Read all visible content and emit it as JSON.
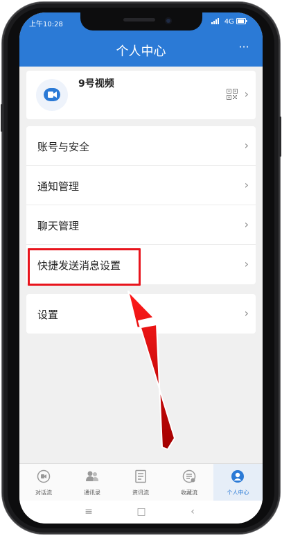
{
  "status_bar": {
    "time": "上午10:28",
    "network": "4G"
  },
  "header": {
    "title": "个人中心",
    "more_label": "···"
  },
  "profile": {
    "name": "9号视频"
  },
  "menu_group_1": [
    {
      "label": "账号与安全"
    },
    {
      "label": "通知管理"
    },
    {
      "label": "聊天管理"
    },
    {
      "label": "快捷发送消息设置"
    }
  ],
  "menu_group_2": [
    {
      "label": "设置"
    }
  ],
  "tab_bar": [
    {
      "label": "对话流",
      "icon": "chat-bubble-icon"
    },
    {
      "label": "通讯录",
      "icon": "contacts-icon"
    },
    {
      "label": "资讯流",
      "icon": "news-icon"
    },
    {
      "label": "收藏流",
      "icon": "favorites-icon"
    },
    {
      "label": "个人中心",
      "icon": "profile-icon",
      "active": true
    }
  ],
  "colors": {
    "brand": "#2b7ad6",
    "highlight": "#e8141c"
  }
}
